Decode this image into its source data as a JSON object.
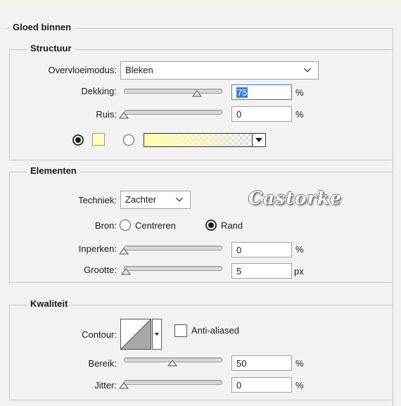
{
  "panel": {
    "title": "Gloed binnen"
  },
  "structure": {
    "title": "Structuur",
    "blend_mode_label": "Overvloeimodus:",
    "blend_mode_value": "Bleken",
    "opacity_label": "Dekking:",
    "opacity_value": "75",
    "opacity_unit": "%",
    "opacity_level": 0.75,
    "noise_label": "Ruis:",
    "noise_value": "0",
    "noise_unit": "%",
    "noise_level": 0,
    "color_swatch": "#ffffc0",
    "gradient_color": "#ffffb0"
  },
  "elements": {
    "title": "Elementen",
    "technique_label": "Techniek:",
    "technique_value": "Zachter",
    "source_label": "Bron:",
    "source_center": "Centreren",
    "source_edge": "Rand",
    "choke_label": "Inperken:",
    "choke_value": "0",
    "choke_unit": "%",
    "choke_level": 0,
    "size_label": "Grootte:",
    "size_value": "5",
    "size_unit": "px",
    "size_level": 0.02,
    "watermark": "Castorke"
  },
  "quality": {
    "title": "Kwaliteit",
    "contour_label": "Contour:",
    "anti_aliased_label": "Anti-aliased",
    "anti_aliased_checked": false,
    "range_label": "Bereik:",
    "range_value": "50",
    "range_unit": "%",
    "range_level": 0.5,
    "jitter_label": "Jitter:",
    "jitter_value": "0",
    "jitter_unit": "%",
    "jitter_level": 0
  },
  "colors": {
    "accent": "#3c7fd1",
    "panel_bg": "#f2f2f2",
    "border": "#c8c8c8"
  }
}
